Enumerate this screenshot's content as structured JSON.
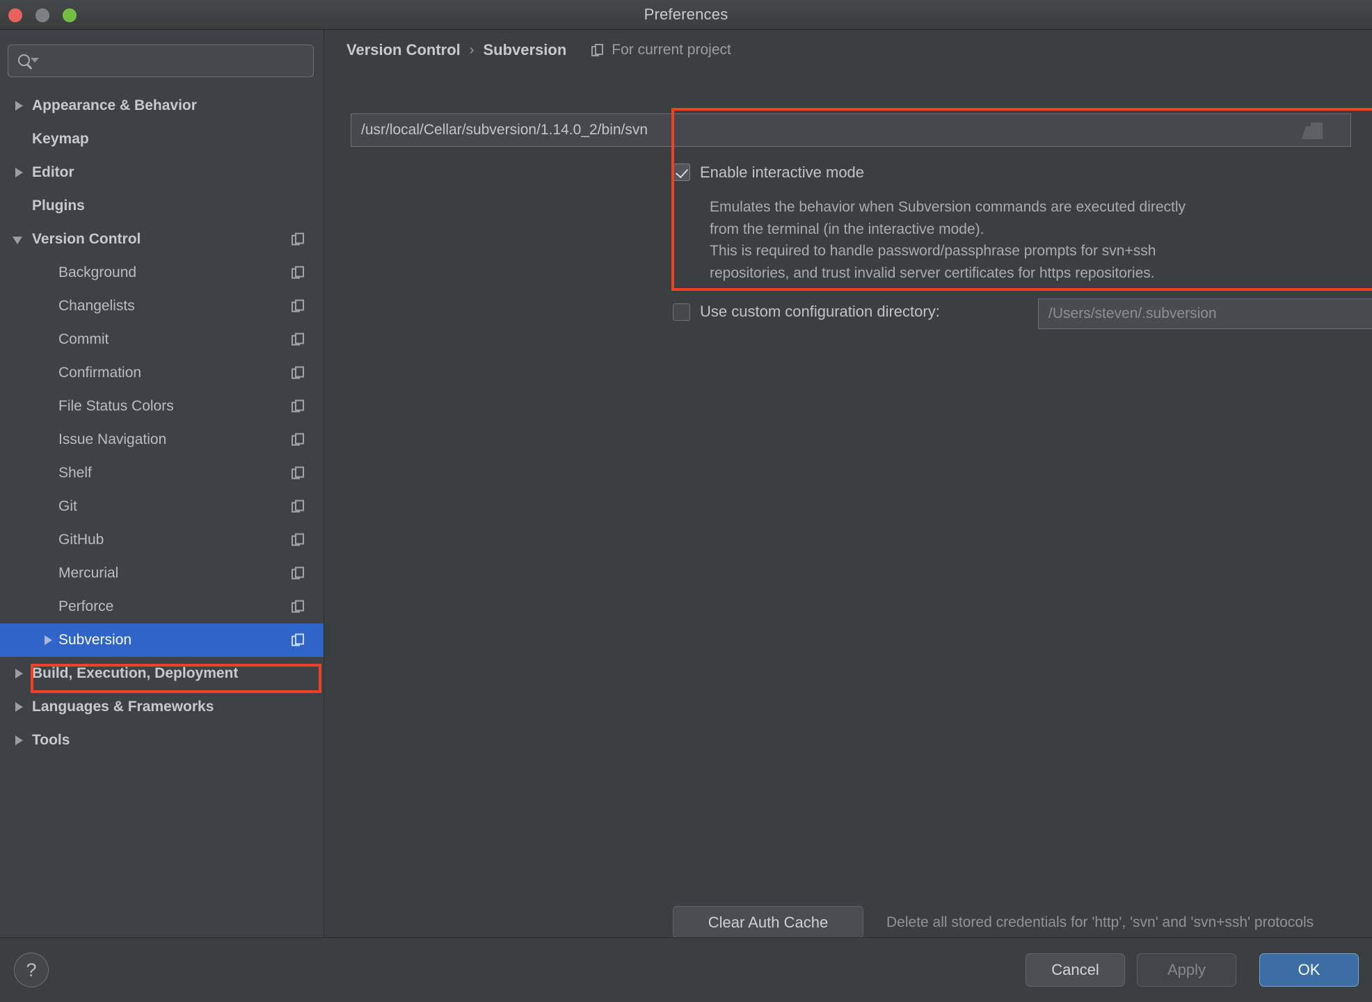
{
  "window": {
    "title": "Preferences",
    "traffic_lights": [
      "close",
      "minimize",
      "zoom"
    ]
  },
  "sidebar": {
    "search": {
      "placeholder": "",
      "value": "",
      "icon": "search-icon"
    },
    "items": [
      {
        "label": "Appearance & Behavior",
        "level": 0,
        "expander": "right",
        "copy_icon": false,
        "selected": false
      },
      {
        "label": "Keymap",
        "level": 0,
        "expander": "none",
        "copy_icon": false,
        "selected": false
      },
      {
        "label": "Editor",
        "level": 0,
        "expander": "right",
        "copy_icon": false,
        "selected": false
      },
      {
        "label": "Plugins",
        "level": 0,
        "expander": "none",
        "copy_icon": false,
        "selected": false
      },
      {
        "label": "Version Control",
        "level": 0,
        "expander": "down",
        "copy_icon": true,
        "selected": false
      },
      {
        "label": "Background",
        "level": 1,
        "expander": "none",
        "copy_icon": true,
        "selected": false
      },
      {
        "label": "Changelists",
        "level": 1,
        "expander": "none",
        "copy_icon": true,
        "selected": false
      },
      {
        "label": "Commit",
        "level": 1,
        "expander": "none",
        "copy_icon": true,
        "selected": false
      },
      {
        "label": "Confirmation",
        "level": 1,
        "expander": "none",
        "copy_icon": true,
        "selected": false
      },
      {
        "label": "File Status Colors",
        "level": 1,
        "expander": "none",
        "copy_icon": true,
        "selected": false
      },
      {
        "label": "Issue Navigation",
        "level": 1,
        "expander": "none",
        "copy_icon": true,
        "selected": false
      },
      {
        "label": "Shelf",
        "level": 1,
        "expander": "none",
        "copy_icon": true,
        "selected": false
      },
      {
        "label": "Git",
        "level": 1,
        "expander": "none",
        "copy_icon": true,
        "selected": false
      },
      {
        "label": "GitHub",
        "level": 1,
        "expander": "none",
        "copy_icon": true,
        "selected": false
      },
      {
        "label": "Mercurial",
        "level": 1,
        "expander": "none",
        "copy_icon": true,
        "selected": false
      },
      {
        "label": "Perforce",
        "level": 1,
        "expander": "none",
        "copy_icon": true,
        "selected": false
      },
      {
        "label": "Subversion",
        "level": 1,
        "expander": "right",
        "copy_icon": true,
        "selected": true
      },
      {
        "label": "Build, Execution, Deployment",
        "level": 0,
        "expander": "right",
        "copy_icon": false,
        "selected": false
      },
      {
        "label": "Languages & Frameworks",
        "level": 0,
        "expander": "right",
        "copy_icon": false,
        "selected": false
      },
      {
        "label": "Tools",
        "level": 0,
        "expander": "right",
        "copy_icon": false,
        "selected": false
      }
    ]
  },
  "main": {
    "breadcrumb": {
      "parent": "Version Control",
      "separator": "›",
      "current": "Subversion",
      "scope_label": "For current project"
    },
    "svn_path": {
      "value": "/usr/local/Cellar/subversion/1.14.0_2/bin/svn",
      "placeholder": "",
      "browse_icon": "folder-browse-icon"
    },
    "interactive_mode": {
      "label": "Enable interactive mode",
      "checked": true,
      "description_lines": [
        "Emulates the behavior when Subversion commands are executed directly",
        "from the terminal (in the interactive mode).",
        "This is required to handle password/passphrase prompts for svn+ssh",
        "repositories, and trust invalid server certificates for https repositories."
      ]
    },
    "custom_config": {
      "label": "Use custom configuration directory:",
      "checked": false,
      "value": "/Users/steven/.subversion",
      "browse_icon": "folder-browse-icon"
    },
    "clear_auth": {
      "button_label": "Clear Auth Cache",
      "note": "Delete all stored credentials for 'http', 'svn' and 'svn+ssh' protocols"
    }
  },
  "footer": {
    "help_label": "?",
    "cancel_label": "Cancel",
    "apply_label": "Apply",
    "apply_enabled": false,
    "ok_label": "OK"
  },
  "colors": {
    "accent_selection": "#2f65c9",
    "annotation_red": "#f04123",
    "ok_button": "#3c6ea5",
    "sidebar_bg": "#3e4247",
    "panel_bg": "#3c3f41"
  }
}
